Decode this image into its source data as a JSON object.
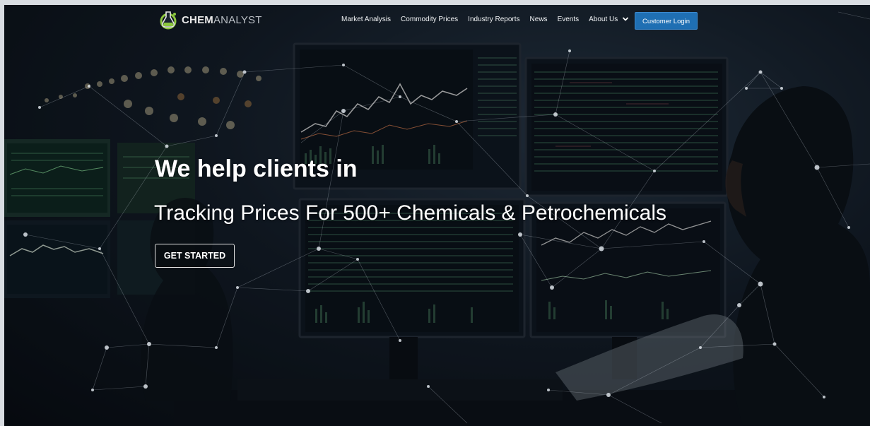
{
  "brand": {
    "name_part1": "CHEM",
    "name_part2": "ANALYST",
    "accent_color": "#8cc63f"
  },
  "nav": {
    "items": [
      {
        "label": "Market Analysis"
      },
      {
        "label": "Commodity Prices"
      },
      {
        "label": "Industry Reports"
      },
      {
        "label": "News"
      },
      {
        "label": "Events"
      },
      {
        "label": "About Us"
      }
    ],
    "about_menu_icon": "chevron-down-icon",
    "login_label": "Customer Login",
    "login_color": "#1f6fb3"
  },
  "hero": {
    "headline": "We help clients in",
    "subline": "Tracking Prices For 500+ Chemicals & Petrochemicals",
    "cta_label": "GET STARTED",
    "background": "trading-desk-monitors-with-network-overlay"
  }
}
